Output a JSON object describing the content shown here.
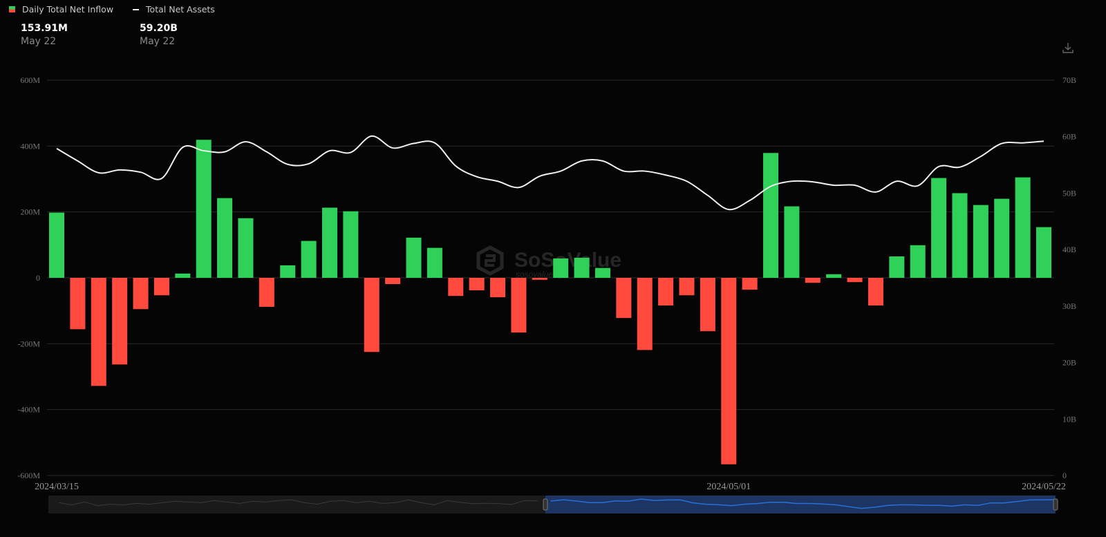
{
  "legend": {
    "inflow_label": "Daily Total Net Inflow",
    "assets_label": "Total Net Assets"
  },
  "tooltip": {
    "inflow_value": "153.91M",
    "inflow_date": "May 22",
    "assets_value": "59.20B",
    "assets_date": "May 22"
  },
  "watermark": {
    "brand": "SoSoValue",
    "url": "sosovalue.xyz"
  },
  "colors": {
    "positive": "#2fd158",
    "negative": "#ff4a3d",
    "line": "#f0f0f0",
    "grid": "#2a2a2a",
    "navigator": "#1c3563",
    "navigator_line": "#2a6fd6"
  },
  "chart_data": {
    "type": "bar+line",
    "x_ticks": [
      {
        "index": 0,
        "label": "2024/03/15"
      },
      {
        "index": 32,
        "label": "2024/05/01"
      },
      {
        "index": 47,
        "label": "2024/05/22"
      }
    ],
    "y_left": {
      "label": "Daily Total Net Inflow",
      "range": [
        -600,
        600
      ],
      "unit": "M",
      "ticks": [
        "600M",
        "400M",
        "200M",
        "0",
        "-200M",
        "-400M",
        "-600M"
      ],
      "tick_values": [
        600,
        400,
        200,
        0,
        -200,
        -400,
        -600
      ]
    },
    "y_right": {
      "label": "Total Net Assets",
      "range": [
        0,
        70
      ],
      "unit": "B",
      "ticks": [
        "70B",
        "60B",
        "50B",
        "40B",
        "30B",
        "20B",
        "10B",
        "0"
      ],
      "tick_values": [
        70,
        60,
        50,
        40,
        30,
        20,
        10,
        0
      ]
    },
    "series": [
      {
        "name": "Daily Total Net Inflow",
        "type": "bar",
        "axis": "left",
        "values": [
          198,
          -156,
          -328,
          -263,
          -95,
          -53,
          13,
          419,
          242,
          181,
          -88,
          38,
          112,
          213,
          202,
          -225,
          -19,
          122,
          91,
          -55,
          -38,
          -59,
          -166,
          -6,
          59,
          61,
          30,
          -122,
          -219,
          -84,
          -53,
          -162,
          -566,
          -36,
          379,
          217,
          -15,
          11,
          -13,
          -84,
          65,
          99,
          303,
          257,
          221,
          240,
          305,
          153.91
        ]
      },
      {
        "name": "Total Net Assets",
        "type": "line",
        "axis": "right",
        "values": [
          57.9,
          55.7,
          53.6,
          54.1,
          53.7,
          52.6,
          58.1,
          57.5,
          57.3,
          59.1,
          57.3,
          55.1,
          55.2,
          57.5,
          57.2,
          60.1,
          58.0,
          58.8,
          58.9,
          54.8,
          52.9,
          52.1,
          51.0,
          53.0,
          53.9,
          55.7,
          55.7,
          53.9,
          53.9,
          53.2,
          52.1,
          49.6,
          47.1,
          48.7,
          51.2,
          52.1,
          52.0,
          51.4,
          51.4,
          50.2,
          52.1,
          51.3,
          54.7,
          54.6,
          56.5,
          58.8,
          58.9,
          59.2
        ]
      }
    ],
    "grid": true,
    "legend_position": "top-left"
  }
}
